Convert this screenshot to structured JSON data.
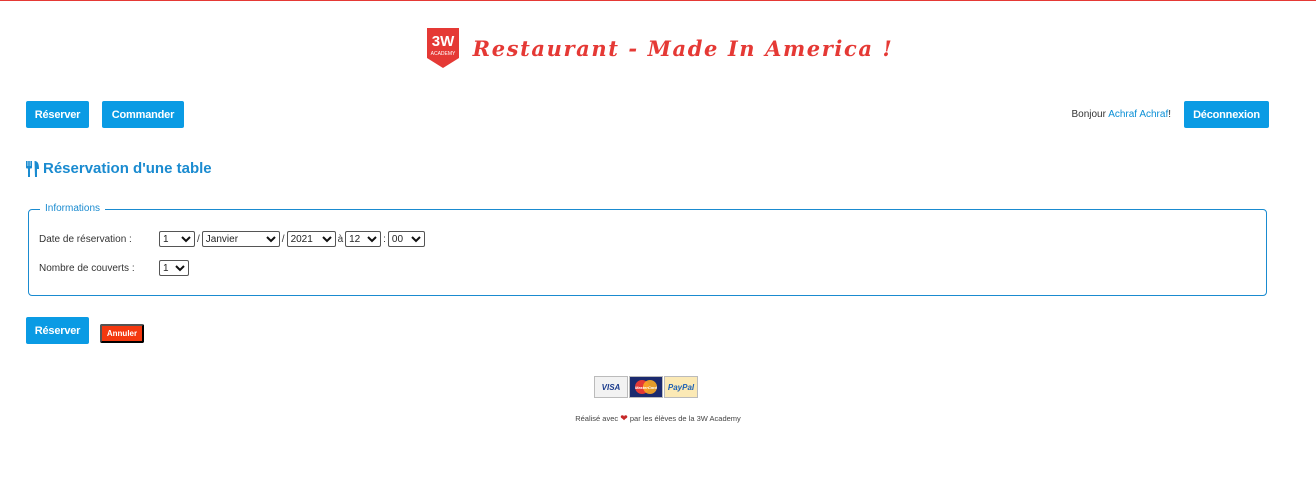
{
  "header": {
    "logo_text": "3W",
    "logo_subtext": "ACADEMY",
    "title": "Restaurant - Made In America !",
    "brand_color": "#e53935"
  },
  "nav": {
    "reserver_label": "Réserver",
    "commander_label": "Commander",
    "greeting_prefix": "Bonjour",
    "user_name": "Achraf Achraf",
    "greeting_suffix": "!",
    "logout_label": "Déconnexion",
    "accent_color": "#0a9be4"
  },
  "section": {
    "icon": "utensils-icon",
    "title": "Réservation d'une table"
  },
  "form": {
    "legend": "Informations",
    "date_label": "Date de réservation :",
    "day": "1",
    "month": "Janvier",
    "year": "2021",
    "sep_slash": "/",
    "sep_a": "à",
    "hour": "12",
    "sep_colon": ":",
    "minute": "00",
    "covers_label": "Nombre de couverts :",
    "covers": "1"
  },
  "actions": {
    "submit_label": "Réserver",
    "cancel_label": "Annuler",
    "cancel_color": "#f4380f"
  },
  "payments": {
    "visa": "VISA",
    "mastercard": "MasterCard",
    "paypal": "PayPal"
  },
  "footer": {
    "prefix": "Réalisé avec",
    "suffix": "par les élèves de la 3W Academy",
    "heart_icon": "heart-icon"
  }
}
